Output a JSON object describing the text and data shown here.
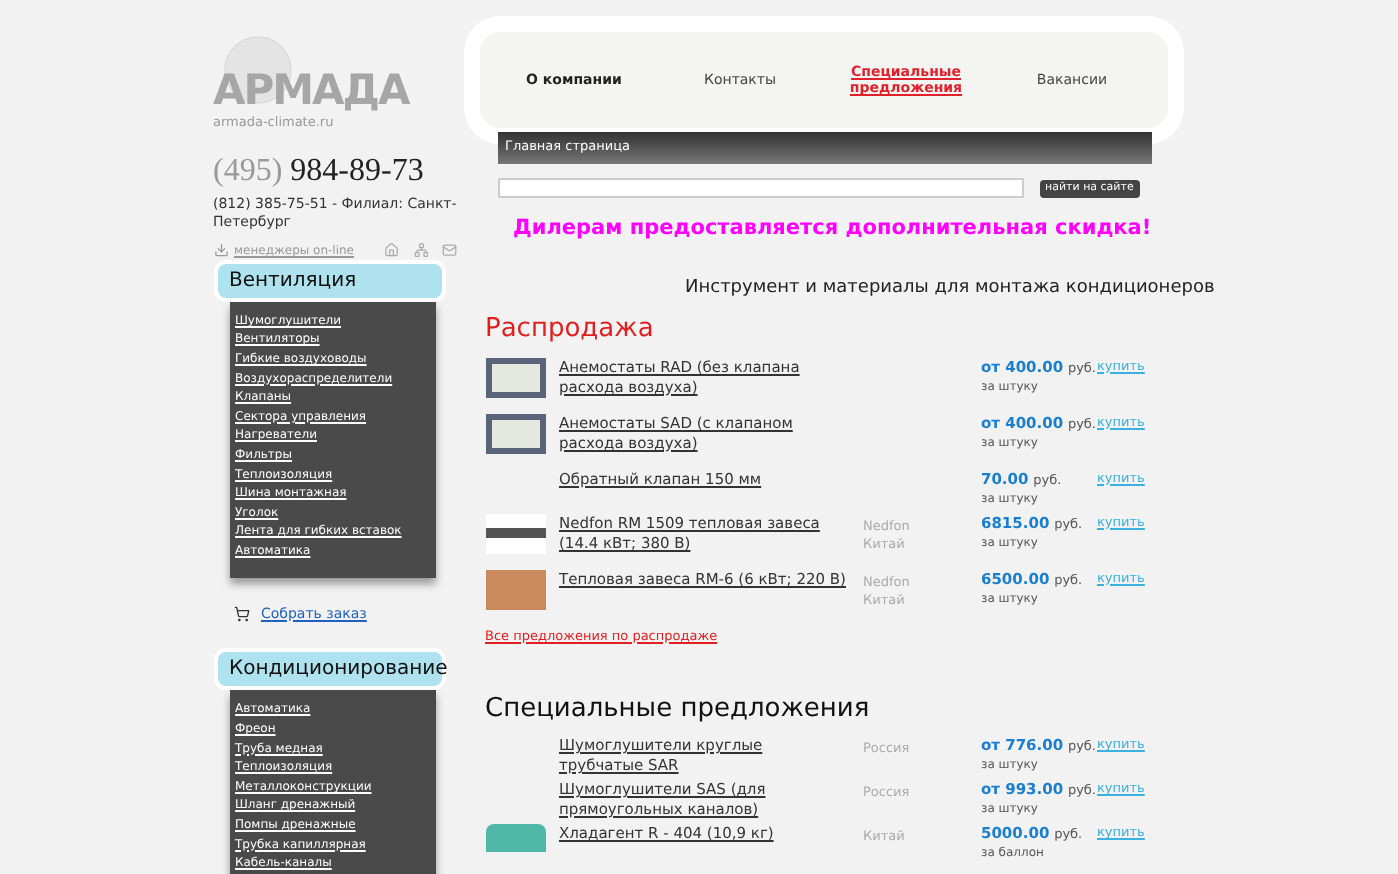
{
  "logo": {
    "name": "АРМАДА",
    "site": "armada-climate.ru"
  },
  "contacts": {
    "phone_code": "(495)",
    "phone": "984-89-73",
    "branch": "(812) 385-75-51 - Филиал: Санкт-Петербург",
    "managers_link": "менеджеры on-line"
  },
  "nav": [
    {
      "label": "О компании",
      "kind": "bold"
    },
    {
      "label": "Контакты",
      "kind": "plain"
    },
    {
      "label": "Специальные предложения",
      "kind": "highlight"
    },
    {
      "label": "Вакансии",
      "kind": "plain"
    }
  ],
  "breadcrumb": "Главная страница",
  "search": {
    "button": "найти на сайте"
  },
  "promo": "Дилерам предоставляется дополнительная скидка!",
  "sidebar": [
    {
      "title": "Вентиляция",
      "items": [
        "Шумоглушители",
        "Вентиляторы",
        "Гибкие воздуховоды",
        "Воздухораспределители",
        "Клапаны",
        "Сектора управления",
        "Нагреватели",
        "Фильтры",
        "Теплоизоляция",
        "Шина монтажная",
        "Уголок",
        "Лента для гибких вставок",
        "Автоматика"
      ]
    },
    {
      "title": "Кондиционирование",
      "items": [
        "Автоматика",
        "Фреон",
        "Труба медная",
        "Теплоизоляция",
        "Металлоконструкции",
        "Шланг дренажный",
        "Помпы дренажные",
        "Трубка капиллярная",
        "Кабель-каналы"
      ]
    }
  ],
  "order_link": "Собрать заказ",
  "page_title": "Инструмент и материалы для монтажа кондиционеров",
  "sale": {
    "title": "Распродажа",
    "all_link": "Все предложения по распродаже",
    "rows": [
      {
        "kind": "diffuser",
        "name": "Анемостаты RAD (без клапана расхода воздуха)",
        "price": "от 400.00",
        "currency": "руб.",
        "unit": "за штуку",
        "buy": "купить"
      },
      {
        "kind": "diffuser",
        "name": "Анемостаты SAD (с клапаном расхода воздуха)",
        "price": "от 400.00",
        "currency": "руб.",
        "unit": "за штуку",
        "buy": "купить"
      },
      {
        "kind": "plain",
        "name": "Обратный клапан 150 мм",
        "price": "70.00",
        "currency": "руб.",
        "unit": "за штуку",
        "buy": "купить"
      },
      {
        "kind": "curtain",
        "name": "Nedfon RM 1509 тепловая завеса (14.4 кВт; 380 В)",
        "maker": "Nedfon",
        "country": "Китай",
        "price": "6815.00",
        "currency": "руб.",
        "unit": "за штуку",
        "buy": "купить"
      },
      {
        "kind": "curtain-wood",
        "name": "Тепловая завеса RM-6 (6 кВт; 220 В)",
        "maker": "Nedfon",
        "country": "Китай",
        "price": "6500.00",
        "currency": "руб.",
        "unit": "за штуку",
        "buy": "купить"
      }
    ]
  },
  "special": {
    "title": "Специальные предложения",
    "rows": [
      {
        "kind": "plain",
        "name": "Шумоглушители круглые трубчатые SAR",
        "country": "Россия",
        "price": "от 776.00",
        "currency": "руб.",
        "unit": "за штуку",
        "buy": "купить"
      },
      {
        "kind": "plain",
        "name": "Шумоглушители SAS (для прямоугольных каналов)",
        "country": "Россия",
        "price": "от 993.00",
        "currency": "руб.",
        "unit": "за штуку",
        "buy": "купить"
      },
      {
        "kind": "cylinder",
        "name": "Хладагент R - 404 (10,9 кг)",
        "country": "Китай",
        "price": "5000.00",
        "currency": "руб.",
        "unit": "за баллон",
        "buy": "купить"
      }
    ]
  }
}
